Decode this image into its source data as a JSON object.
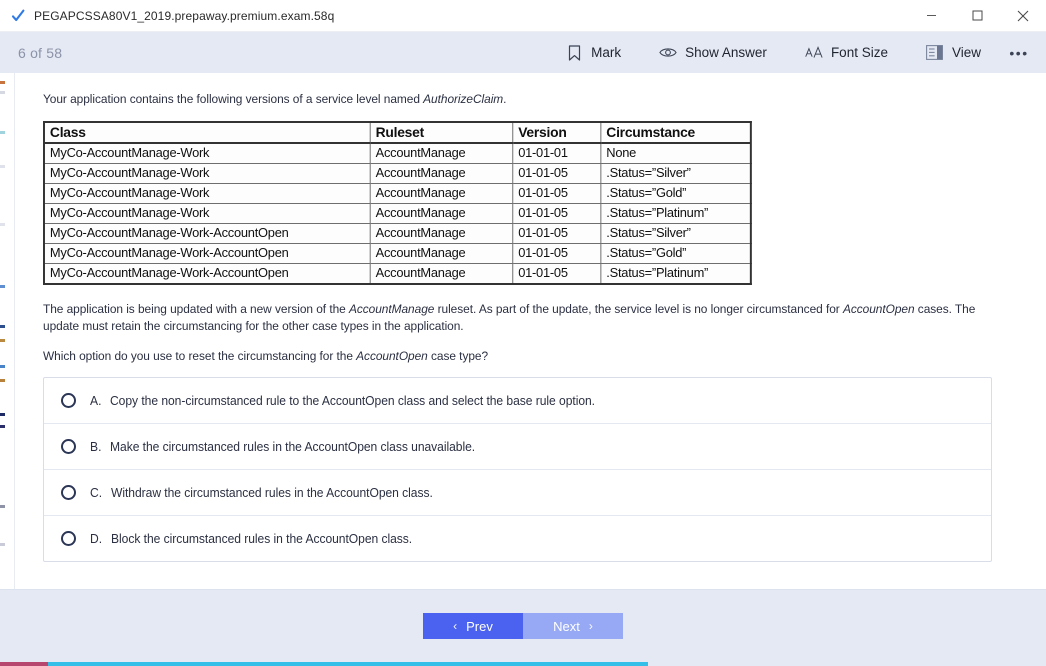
{
  "window": {
    "title": "PEGAPCSSA80V1_2019.prepaway.premium.exam.58q",
    "app_icon": "blue-checkmark-icon",
    "controls": {
      "minimize": "—",
      "maximize": "□",
      "close": "✕"
    }
  },
  "toolbar": {
    "progress": "6 of 58",
    "actions": [
      {
        "icon": "bookmark-icon",
        "label": "Mark"
      },
      {
        "icon": "eye-icon",
        "label": "Show Answer"
      },
      {
        "icon": "font-size-icon",
        "label": "Font Size"
      },
      {
        "icon": "view-layout-icon",
        "label": "View"
      }
    ],
    "more_label": "•••"
  },
  "question": {
    "intro_before": "Your application contains the following versions of a service level named ",
    "intro_italic": "AuthorizeClaim",
    "intro_after": ".",
    "table": {
      "headers": [
        "Class",
        "Ruleset",
        "Version",
        "Circumstance"
      ],
      "rows": [
        [
          "MyCo-AccountManage-Work",
          "AccountManage",
          "01-01-01",
          "None"
        ],
        [
          "MyCo-AccountManage-Work",
          "AccountManage",
          "01-01-05",
          ".Status=”Silver”"
        ],
        [
          "MyCo-AccountManage-Work",
          "AccountManage",
          "01-01-05",
          ".Status=”Gold”"
        ],
        [
          "MyCo-AccountManage-Work",
          "AccountManage",
          "01-01-05",
          ".Status=”Platinum”"
        ],
        [
          "MyCo-AccountManage-Work-AccountOpen",
          "AccountManage",
          "01-01-05",
          ".Status=”Silver”"
        ],
        [
          "MyCo-AccountManage-Work-AccountOpen",
          "AccountManage",
          "01-01-05",
          ".Status=”Gold”"
        ],
        [
          "MyCo-AccountManage-Work-AccountOpen",
          "AccountManage",
          "01-01-05",
          ".Status=”Platinum”"
        ]
      ]
    },
    "body_p1_a": "The application is being updated with a new version of the ",
    "body_p1_i1": "AccountManage",
    "body_p1_b": " ruleset. As part of the update, the service level is no longer circumstanced for ",
    "body_p1_i2": "AccountOpen",
    "body_p1_c": " cases. The update must retain the circumstancing for the other case types in the application.",
    "prompt_a": "Which option do you use to reset the circumstancing for the ",
    "prompt_i": "AccountOpen",
    "prompt_b": " case type?",
    "options": [
      {
        "letter": "A.",
        "text": "Copy the non-circumstanced rule to the AccountOpen class and select the base rule option.",
        "selected": false
      },
      {
        "letter": "B.",
        "text": "Make the circumstanced rules in the AccountOpen class unavailable.",
        "selected": false
      },
      {
        "letter": "C.",
        "text": "Withdraw the circumstanced rules in the AccountOpen class.",
        "selected": false
      },
      {
        "letter": "D.",
        "text": "Block the circumstanced rules in the AccountOpen class.",
        "selected": false
      }
    ]
  },
  "footer": {
    "prev_label": "Prev",
    "next_label": "Next",
    "prev_chevron": "‹",
    "next_chevron": "›"
  },
  "colors": {
    "toolbar_bg": "#e5e9f4",
    "prev_button": "#4a62ef",
    "next_button": "#97a9f4",
    "accent_check": "#2f7ae5",
    "status_cyan": "#34bfe8",
    "status_magenta": "#b8476f"
  }
}
